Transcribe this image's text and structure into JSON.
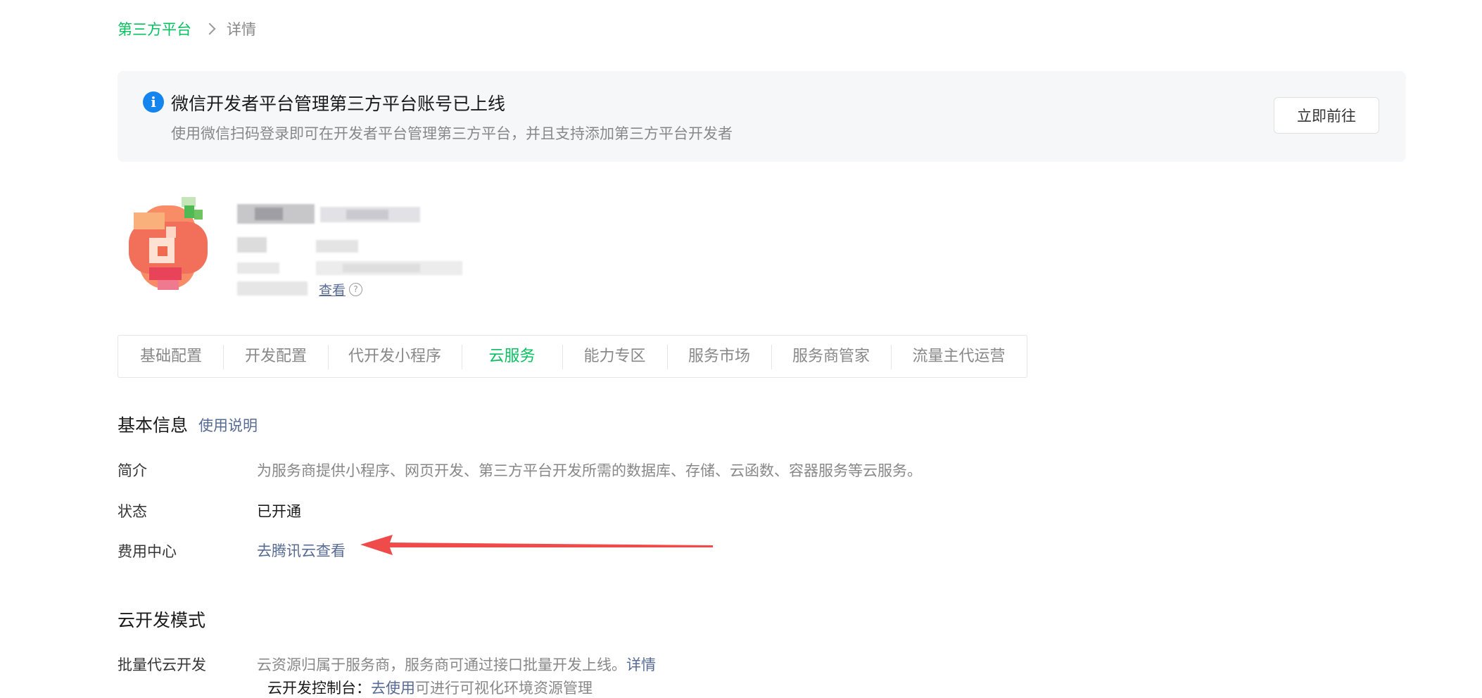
{
  "breadcrumb": {
    "parent": "第三方平台",
    "current": "详情"
  },
  "notice": {
    "icon": "info-icon",
    "title": "微信开发者平台管理第三方平台账号已上线",
    "description": "使用微信扫码登录即可在开发者平台管理第三方平台，并且支持添加第三方平台开发者",
    "button_label": "立即前往"
  },
  "profile": {
    "view_link": "查看"
  },
  "tabs": [
    {
      "label": "基础配置",
      "active": false
    },
    {
      "label": "开发配置",
      "active": false
    },
    {
      "label": "代开发小程序",
      "active": false
    },
    {
      "label": "云服务",
      "active": true
    },
    {
      "label": "能力专区",
      "active": false
    },
    {
      "label": "服务市场",
      "active": false
    },
    {
      "label": "服务商管家",
      "active": false
    },
    {
      "label": "流量主代运营",
      "active": false
    }
  ],
  "basic_info": {
    "title": "基本信息",
    "help_link": "使用说明",
    "rows": [
      {
        "label": "简介",
        "value": "为服务商提供小程序、网页开发、第三方平台开发所需的数据库、存储、云函数、容器服务等云服务。"
      },
      {
        "label": "状态",
        "value": "已开通"
      },
      {
        "label": "费用中心",
        "value": "去腾讯云查看"
      }
    ]
  },
  "cloud_dev": {
    "title": "云开发模式",
    "row_label": "批量代云开发",
    "row_value": "云资源归属于服务商，服务商可通过接口批量开发上线。",
    "row_link": "详情",
    "sub_text_a": "云开发控制台：",
    "sub_link": "去使用",
    "sub_text_b": "可进行可视化环境资源管理"
  },
  "colors": {
    "brand_green": "#07c160",
    "link_blue": "#576b95",
    "info_blue": "#1485ee",
    "annotation_red": "#f04b4b"
  }
}
